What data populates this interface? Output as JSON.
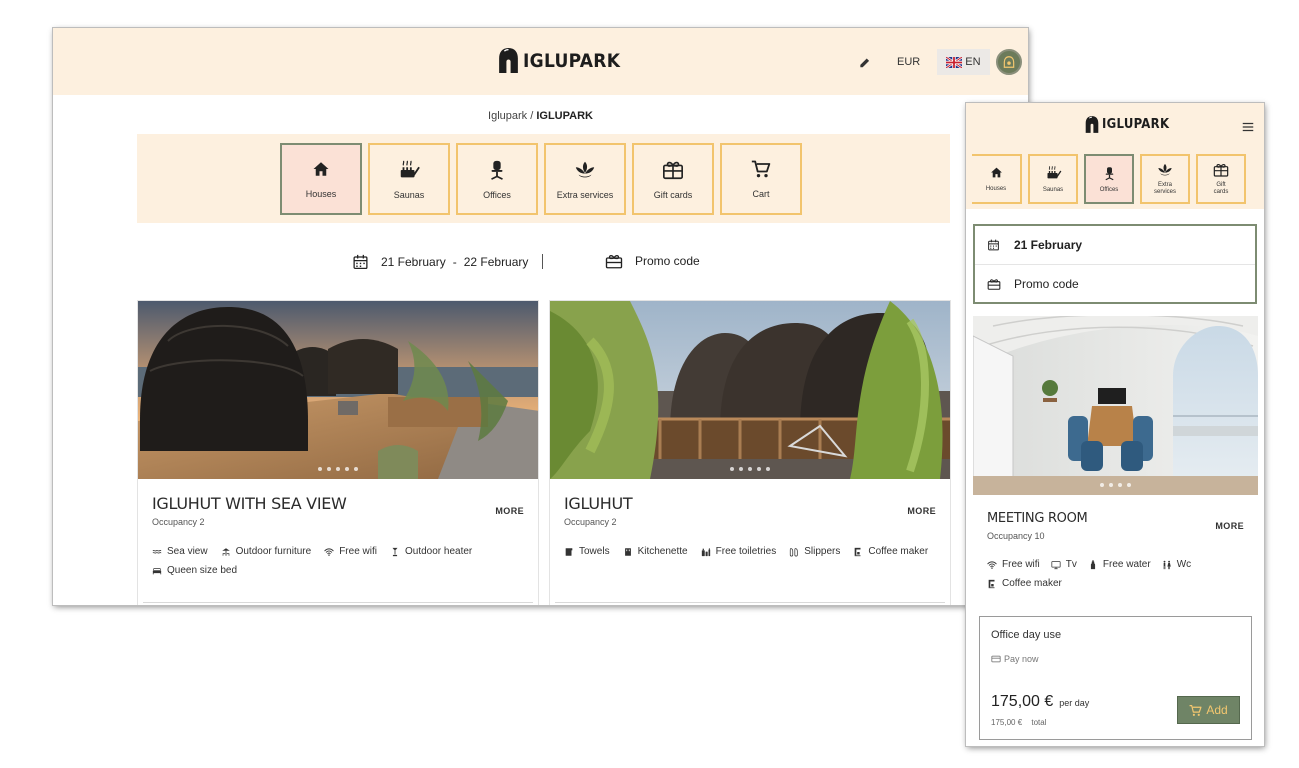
{
  "brand": {
    "name": "IGLUPARK"
  },
  "header": {
    "currency": "EUR",
    "language": "EN"
  },
  "breadcrumb": {
    "home": "Iglupark",
    "separator": " / ",
    "current": "IGLUPARK"
  },
  "categories": [
    {
      "label": "Houses",
      "icon": "house-icon"
    },
    {
      "label": "Saunas",
      "icon": "sauna-icon"
    },
    {
      "label": "Offices",
      "icon": "office-chair-icon"
    },
    {
      "label": "Extra services",
      "icon": "lotus-icon"
    },
    {
      "label": "Gift cards",
      "icon": "gift-card-icon"
    },
    {
      "label": "Cart",
      "icon": "cart-icon"
    }
  ],
  "mobile_categories": [
    {
      "line1": "Houses",
      "line2": ""
    },
    {
      "line1": "Saunas",
      "line2": ""
    },
    {
      "line1": "Offices",
      "line2": ""
    },
    {
      "line1": "Extra",
      "line2": "services"
    },
    {
      "line1": "Gift",
      "line2": "cards"
    }
  ],
  "search": {
    "date_from": "21 February",
    "date_sep": "-",
    "date_to": "22 February",
    "promo_label": "Promo code"
  },
  "listings": [
    {
      "title": "IGLUHUT WITH SEA VIEW",
      "occupancy": "Occupancy 2",
      "more": "MORE",
      "amenities": [
        {
          "label": "Sea view",
          "icon": "sea-view-icon"
        },
        {
          "label": "Outdoor furniture",
          "icon": "furniture-icon"
        },
        {
          "label": "Free wifi",
          "icon": "wifi-icon"
        },
        {
          "label": "Outdoor heater",
          "icon": "heater-icon"
        },
        {
          "label": "Queen size bed",
          "icon": "bed-icon"
        }
      ]
    },
    {
      "title": "IGLUHUT",
      "occupancy": "Occupancy 2",
      "more": "MORE",
      "amenities": [
        {
          "label": "Towels",
          "icon": "towel-icon"
        },
        {
          "label": "Kitchenette",
          "icon": "kitchen-icon"
        },
        {
          "label": "Free toiletries",
          "icon": "toiletries-icon"
        },
        {
          "label": "Slippers",
          "icon": "slippers-icon"
        },
        {
          "label": "Coffee maker",
          "icon": "coffee-maker-icon"
        }
      ]
    }
  ],
  "mobile": {
    "date": "21 February",
    "promo_label": "Promo code",
    "listing": {
      "title": "MEETING ROOM",
      "occupancy": "Occupancy 10",
      "more": "MORE",
      "amenities": [
        {
          "label": "Free wifi",
          "icon": "wifi-icon"
        },
        {
          "label": "Tv",
          "icon": "tv-icon"
        },
        {
          "label": "Free water",
          "icon": "water-bottle-icon"
        },
        {
          "label": "Wc",
          "icon": "wc-icon"
        },
        {
          "label": "Coffee maker",
          "icon": "coffee-maker-icon"
        }
      ]
    },
    "offer": {
      "title": "Office day use",
      "payment": "Pay now",
      "price": "175,00 €",
      "unit": "per day",
      "total_value": "175,00 €",
      "total_label": "total",
      "add_label": "Add"
    }
  },
  "colors": {
    "header_bg": "#fdf0df",
    "tile_border": "#f2c46d",
    "active_border": "#7d8c72",
    "active_bg": "#fbe1d6",
    "add_button": "#6f8466",
    "add_text": "#f3c76f"
  }
}
